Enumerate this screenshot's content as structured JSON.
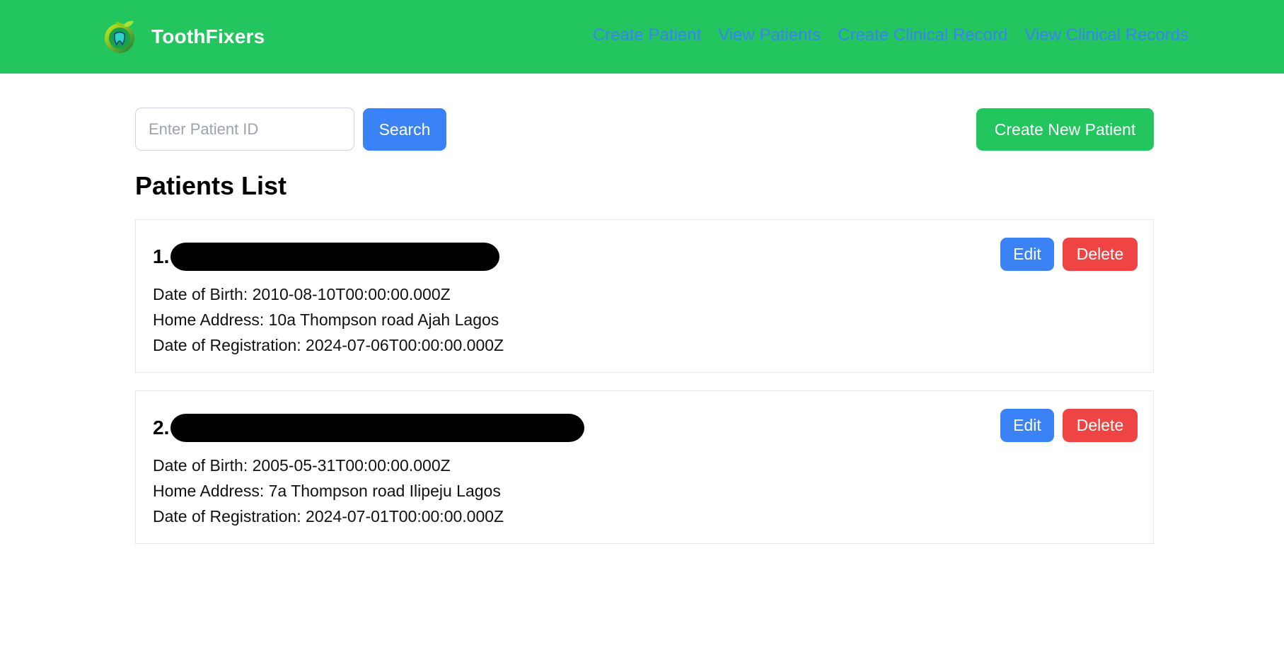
{
  "navbar": {
    "brand": "ToothFixers",
    "links": [
      "Create Patient",
      "View Patients",
      "Create Clinical Record",
      "View Clinical Records"
    ],
    "logo_icon": "tooth-logo-icon"
  },
  "toolbar": {
    "search_placeholder": "Enter Patient ID",
    "search_value": "",
    "search_label": "Search",
    "create_label": "Create New Patient"
  },
  "page": {
    "title": "Patients List"
  },
  "patients": [
    {
      "index": "1.",
      "name": "",
      "dob": "Date of Birth: 2010-08-10T00:00:00.000Z",
      "address": "Home Address: 10a Thompson road Ajah Lagos",
      "registered": "Date of Registration: 2024-07-06T00:00:00.000Z",
      "edit_label": "Edit",
      "delete_label": "Delete"
    },
    {
      "index": "2.",
      "name": "",
      "dob": "Date of Birth: 2005-05-31T00:00:00.000Z",
      "address": "Home Address: 7a Thompson road Ilipeju Lagos",
      "registered": "Date of Registration: 2024-07-01T00:00:00.000Z",
      "edit_label": "Edit",
      "delete_label": "Delete"
    }
  ],
  "colors": {
    "navbar": "#22c55e",
    "link": "#3b82f6",
    "primary": "#3b82f6",
    "success": "#22c55e",
    "danger": "#ef4444"
  }
}
